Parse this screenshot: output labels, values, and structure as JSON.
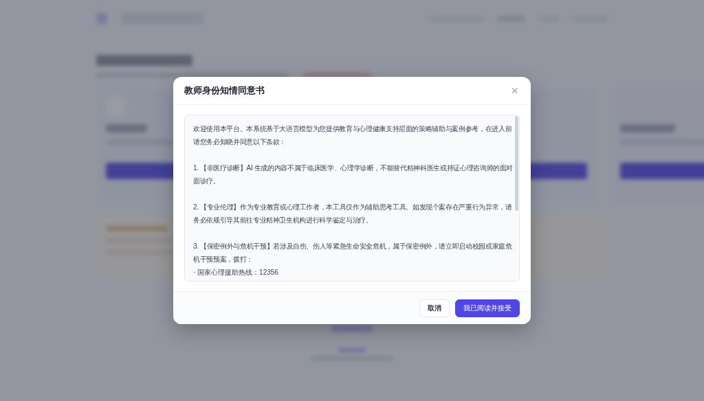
{
  "dialog": {
    "title": "教师身份知情同意书",
    "close": "×",
    "paragraphs": [
      "欢迎使用本平台。本系统基于大语言模型为您提供教育与心理健康支持层面的策略辅助与案例参考，在进入前请您务必知晓并同意以下条款：",
      "1. 【非医疗诊断】AI 生成的内容不属于临床医学、心理学诊断，不能替代精神科医生或持证心理咨询师的面对面诊疗。",
      "2. 【专业伦理】作为专业教育或心理工作者，本工具仅作为辅助思考工具。如发现个案存在严重行为异常，请务必依规引导其前往专业精神卫生机构进行科学鉴定与治疗。",
      "3. 【保密例外与危机干预】若涉及自伤、伤人等紧急生命安全危机，属于保密例外，请立即启动校园或家庭危机干预预案，拨打："
    ],
    "hotline": "· 国家心理援助热线：12356",
    "buttons": [
      {
        "label": "取消",
        "kind": "secondary"
      },
      {
        "label": "我已阅读并接受",
        "kind": "primary"
      }
    ]
  }
}
